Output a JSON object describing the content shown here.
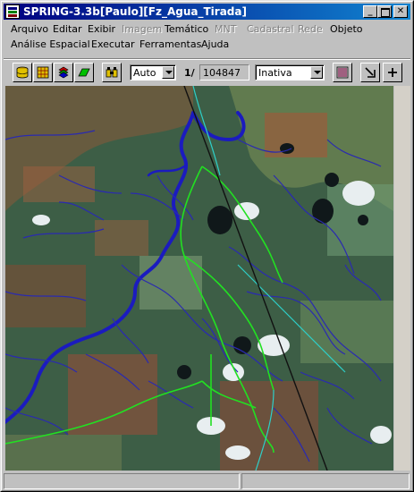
{
  "window": {
    "title": "SPRING-3.3b[Paulo][Fz_Agua_Tirada]"
  },
  "menu": {
    "row1": [
      {
        "label": "Arquivo",
        "enabled": true
      },
      {
        "label": "Editar",
        "enabled": true
      },
      {
        "label": "Exibir",
        "enabled": true
      },
      {
        "label": "Imagem",
        "enabled": false
      },
      {
        "label": "Temático",
        "enabled": true
      },
      {
        "label": "MNT",
        "enabled": false
      },
      {
        "label": "Cadastral",
        "enabled": false
      },
      {
        "label": "Rede",
        "enabled": false
      },
      {
        "label": "Objeto",
        "enabled": true
      }
    ],
    "row2": [
      {
        "label": "Análise Espacial",
        "enabled": true
      },
      {
        "label": "Executar",
        "enabled": true
      },
      {
        "label": "Ferramentas",
        "enabled": true
      },
      {
        "label": "Ajuda",
        "enabled": true
      }
    ]
  },
  "toolbar": {
    "zoom_mode": "Auto",
    "scale_prefix": "1/",
    "scale_value": "104847",
    "cursor_mode": "Inativa"
  },
  "map": {
    "colors": {
      "river": "#1b1bbf",
      "stream": "#2a2ab0",
      "boundary": "#22e022",
      "road": "#111111",
      "cyan_line": "#2ecfc8"
    }
  }
}
